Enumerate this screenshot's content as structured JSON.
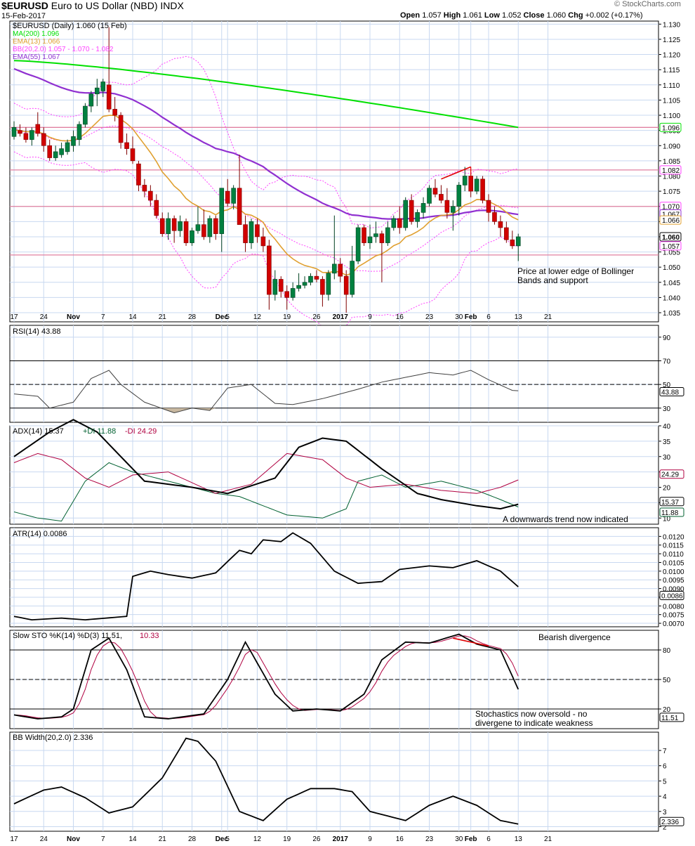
{
  "header": {
    "symbol": "$EURUSD",
    "name": "Euro to US Dollar (NBD)",
    "exchange": "INDX",
    "date": "15-Feb-2017",
    "open_label": "Open",
    "open": "1.057",
    "high_label": "High",
    "high": "1.061",
    "low_label": "Low",
    "low": "1.052",
    "close_label": "Close",
    "close": "1.060",
    "chg_label": "Chg",
    "chg": "+0.002 (+0.17%)",
    "watermark": "© StockCharts.com"
  },
  "colors": {
    "up": "#008040",
    "down": "#d10000",
    "ma200": "#00e000",
    "ema13": "#e0a030",
    "ema55": "#9030d0",
    "bb": "#ff40ff",
    "hline": "#e080a0",
    "grid": "#c8d8f0",
    "panel_bg": "#f0f0ff"
  },
  "chart_data": [
    {
      "type": "candlestick",
      "legend": [
        {
          "text": "$EURUSD (Daily) 1.060 (15 Feb)",
          "color": "#000000"
        },
        {
          "text": "MA(200) 1.096",
          "color": "#00e000"
        },
        {
          "text": "EMA(13) 1.066",
          "color": "#e0a030"
        },
        {
          "text": "BB(20,2.0) 1.057 - 1.070 - 1.082",
          "color": "#ff40ff"
        },
        {
          "text": "EMA(55) 1.067",
          "color": "#9030d0"
        }
      ],
      "ylim": [
        1.032,
        1.131
      ],
      "ticks": [
        "1.035",
        "1.040",
        "1.045",
        "1.050",
        "1.055",
        "1.060",
        "1.065",
        "1.070",
        "1.075",
        "1.080",
        "1.085",
        "1.090",
        "1.095",
        "1.100",
        "1.105",
        "1.110",
        "1.115",
        "1.120",
        "1.125",
        "1.130"
      ],
      "x_labels": [
        {
          "i": 0,
          "text": "17"
        },
        {
          "i": 5,
          "text": "24"
        },
        {
          "i": 10,
          "text": "Nov"
        },
        {
          "i": 15,
          "text": "7"
        },
        {
          "i": 20,
          "text": "14"
        },
        {
          "i": 25,
          "text": "21"
        },
        {
          "i": 30,
          "text": "28"
        },
        {
          "i": 35,
          "text": "Dec"
        },
        {
          "i": 36,
          "text": "5"
        },
        {
          "i": 41,
          "text": "12"
        },
        {
          "i": 46,
          "text": "19"
        },
        {
          "i": 51,
          "text": "26"
        },
        {
          "i": 55,
          "text": "2017"
        },
        {
          "i": 60,
          "text": "9"
        },
        {
          "i": 65,
          "text": "16"
        },
        {
          "i": 70,
          "text": "23"
        },
        {
          "i": 75,
          "text": "30"
        },
        {
          "i": 77,
          "text": "Feb"
        },
        {
          "i": 80,
          "text": "6"
        },
        {
          "i": 85,
          "text": "13"
        },
        {
          "i": 90,
          "text": "21"
        }
      ],
      "hlines": [
        1.096,
        1.082,
        1.07,
        1.054
      ],
      "candles": [
        [
          1.093,
          1.098,
          1.092,
          1.096
        ],
        [
          1.095,
          1.097,
          1.093,
          1.094
        ],
        [
          1.094,
          1.096,
          1.091,
          1.092
        ],
        [
          1.092,
          1.096,
          1.09,
          1.095
        ],
        [
          1.097,
          1.101,
          1.093,
          1.094
        ],
        [
          1.094,
          1.096,
          1.088,
          1.09
        ],
        [
          1.09,
          1.092,
          1.085,
          1.086
        ],
        [
          1.086,
          1.09,
          1.085,
          1.088
        ],
        [
          1.087,
          1.091,
          1.086,
          1.089
        ],
        [
          1.088,
          1.092,
          1.087,
          1.091
        ],
        [
          1.09,
          1.095,
          1.088,
          1.093
        ],
        [
          1.092,
          1.098,
          1.09,
          1.097
        ],
        [
          1.097,
          1.104,
          1.096,
          1.103
        ],
        [
          1.103,
          1.108,
          1.101,
          1.107
        ],
        [
          1.107,
          1.112,
          1.103,
          1.109
        ],
        [
          1.108,
          1.112,
          1.106,
          1.111
        ],
        [
          1.11,
          1.129,
          1.101,
          1.102
        ],
        [
          1.102,
          1.106,
          1.098,
          1.1
        ],
        [
          1.1,
          1.101,
          1.089,
          1.091
        ],
        [
          1.091,
          1.094,
          1.087,
          1.089
        ],
        [
          1.089,
          1.093,
          1.084,
          1.085
        ],
        [
          1.084,
          1.085,
          1.075,
          1.077
        ],
        [
          1.077,
          1.079,
          1.073,
          1.075
        ],
        [
          1.075,
          1.077,
          1.07,
          1.072
        ],
        [
          1.072,
          1.074,
          1.066,
          1.067
        ],
        [
          1.066,
          1.068,
          1.06,
          1.061
        ],
        [
          1.061,
          1.068,
          1.059,
          1.066
        ],
        [
          1.066,
          1.067,
          1.058,
          1.062
        ],
        [
          1.062,
          1.067,
          1.06,
          1.065
        ],
        [
          1.065,
          1.066,
          1.057,
          1.058
        ],
        [
          1.058,
          1.063,
          1.057,
          1.062
        ],
        [
          1.062,
          1.07,
          1.061,
          1.064
        ],
        [
          1.064,
          1.069,
          1.059,
          1.06
        ],
        [
          1.06,
          1.067,
          1.058,
          1.066
        ],
        [
          1.066,
          1.067,
          1.059,
          1.061
        ],
        [
          1.061,
          1.076,
          1.055,
          1.076
        ],
        [
          1.075,
          1.079,
          1.07,
          1.071
        ],
        [
          1.071,
          1.077,
          1.069,
          1.076
        ],
        [
          1.076,
          1.087,
          1.066,
          1.064
        ],
        [
          1.064,
          1.067,
          1.055,
          1.058
        ],
        [
          1.058,
          1.066,
          1.056,
          1.065
        ],
        [
          1.064,
          1.066,
          1.058,
          1.06
        ],
        [
          1.06,
          1.063,
          1.055,
          1.057
        ],
        [
          1.057,
          1.059,
          1.036,
          1.041
        ],
        [
          1.041,
          1.049,
          1.039,
          1.046
        ],
        [
          1.046,
          1.047,
          1.04,
          1.042
        ],
        [
          1.042,
          1.044,
          1.036,
          1.04
        ],
        [
          1.04,
          1.045,
          1.039,
          1.043
        ],
        [
          1.043,
          1.048,
          1.042,
          1.044
        ],
        [
          1.044,
          1.047,
          1.043,
          1.045
        ],
        [
          1.045,
          1.048,
          1.044,
          1.047
        ],
        [
          1.047,
          1.049,
          1.045,
          1.046
        ],
        [
          1.046,
          1.047,
          1.037,
          1.041
        ],
        [
          1.041,
          1.049,
          1.039,
          1.048
        ],
        [
          1.048,
          1.067,
          1.046,
          1.051
        ],
        [
          1.051,
          1.053,
          1.045,
          1.047
        ],
        [
          1.047,
          1.049,
          1.035,
          1.041
        ],
        [
          1.041,
          1.057,
          1.04,
          1.052
        ],
        [
          1.052,
          1.064,
          1.051,
          1.063
        ],
        [
          1.063,
          1.064,
          1.057,
          1.058
        ],
        [
          1.058,
          1.064,
          1.056,
          1.06
        ],
        [
          1.06,
          1.065,
          1.058,
          1.061
        ],
        [
          1.061,
          1.062,
          1.045,
          1.058
        ],
        [
          1.058,
          1.065,
          1.057,
          1.063
        ],
        [
          1.063,
          1.067,
          1.062,
          1.066
        ],
        [
          1.066,
          1.07,
          1.061,
          1.063
        ],
        [
          1.063,
          1.073,
          1.062,
          1.072
        ],
        [
          1.072,
          1.074,
          1.064,
          1.065
        ],
        [
          1.065,
          1.069,
          1.063,
          1.068
        ],
        [
          1.068,
          1.073,
          1.066,
          1.071
        ],
        [
          1.071,
          1.077,
          1.07,
          1.076
        ],
        [
          1.076,
          1.079,
          1.073,
          1.074
        ],
        [
          1.074,
          1.077,
          1.071,
          1.072
        ],
        [
          1.072,
          1.076,
          1.066,
          1.068
        ],
        [
          1.068,
          1.072,
          1.062,
          1.07
        ],
        [
          1.07,
          1.078,
          1.067,
          1.077
        ],
        [
          1.077,
          1.083,
          1.075,
          1.08
        ],
        [
          1.08,
          1.081,
          1.073,
          1.075
        ],
        [
          1.075,
          1.08,
          1.074,
          1.079
        ],
        [
          1.079,
          1.08,
          1.071,
          1.072
        ],
        [
          1.072,
          1.074,
          1.065,
          1.068
        ],
        [
          1.068,
          1.07,
          1.064,
          1.065
        ],
        [
          1.065,
          1.067,
          1.06,
          1.063
        ],
        [
          1.063,
          1.065,
          1.058,
          1.059
        ],
        [
          1.059,
          1.062,
          1.056,
          1.057
        ],
        [
          1.057,
          1.061,
          1.052,
          1.06
        ]
      ],
      "annotations": [
        {
          "text": "Price at lower edge of Bollinger",
          "text2": "Bands and support"
        }
      ]
    },
    {
      "type": "line",
      "legend": [
        {
          "text": "RSI(14) 43.88",
          "color": "#000000"
        }
      ],
      "ylim": [
        18,
        100
      ],
      "ticks": [
        "30",
        "50",
        "70",
        "90"
      ],
      "hlines": [
        30,
        50,
        70
      ],
      "last": "43.88"
    },
    {
      "type": "line",
      "legend": [
        {
          "text": "ADX(14) 15.37",
          "color": "#000000"
        },
        {
          "text": "+DI 11.88",
          "color": "#006030"
        },
        {
          "text": "-DI 24.29",
          "color": "#b00040"
        }
      ],
      "ylim": [
        8,
        40
      ],
      "ticks": [
        "10",
        "15",
        "20",
        "25",
        "30",
        "35",
        "40"
      ],
      "last": [
        "24.29",
        "15.37",
        "11.88"
      ],
      "annotations": [
        {
          "text": "A downwards trend now indicated"
        }
      ]
    },
    {
      "type": "line",
      "legend": [
        {
          "text": "ATR(14) 0.0086",
          "color": "#000000"
        }
      ],
      "ylim": [
        0.0068,
        0.0125
      ],
      "ticks": [
        "0.0070",
        "0.0075",
        "0.0080",
        "0.0085",
        "0.0090",
        "0.0095",
        "0.0100",
        "0.0105",
        "0.0110",
        "0.0115",
        "0.0120"
      ],
      "last": "0.0086"
    },
    {
      "type": "line",
      "legend": [
        {
          "text": "Slow STO %K(14) %D(3) 11.51,",
          "color": "#000000"
        },
        {
          "text": "10.33",
          "color": "#b00040"
        }
      ],
      "ylim": [
        0,
        100
      ],
      "ticks": [
        "20",
        "50",
        "80"
      ],
      "hlines": [
        20,
        50,
        80
      ],
      "last": "11.51",
      "annotations": [
        {
          "text": "Bearish divergence"
        },
        {
          "text": "Stochastics now oversold - no",
          "text2": "divergene to indicate weakness"
        }
      ]
    },
    {
      "type": "line",
      "legend": [
        {
          "text": "BB Width(20,2.0) 2.336",
          "color": "#000000"
        }
      ],
      "ylim": [
        1.7,
        8.2
      ],
      "ticks": [
        "2",
        "3",
        "4",
        "5",
        "6",
        "7"
      ],
      "last": "2.336"
    }
  ]
}
